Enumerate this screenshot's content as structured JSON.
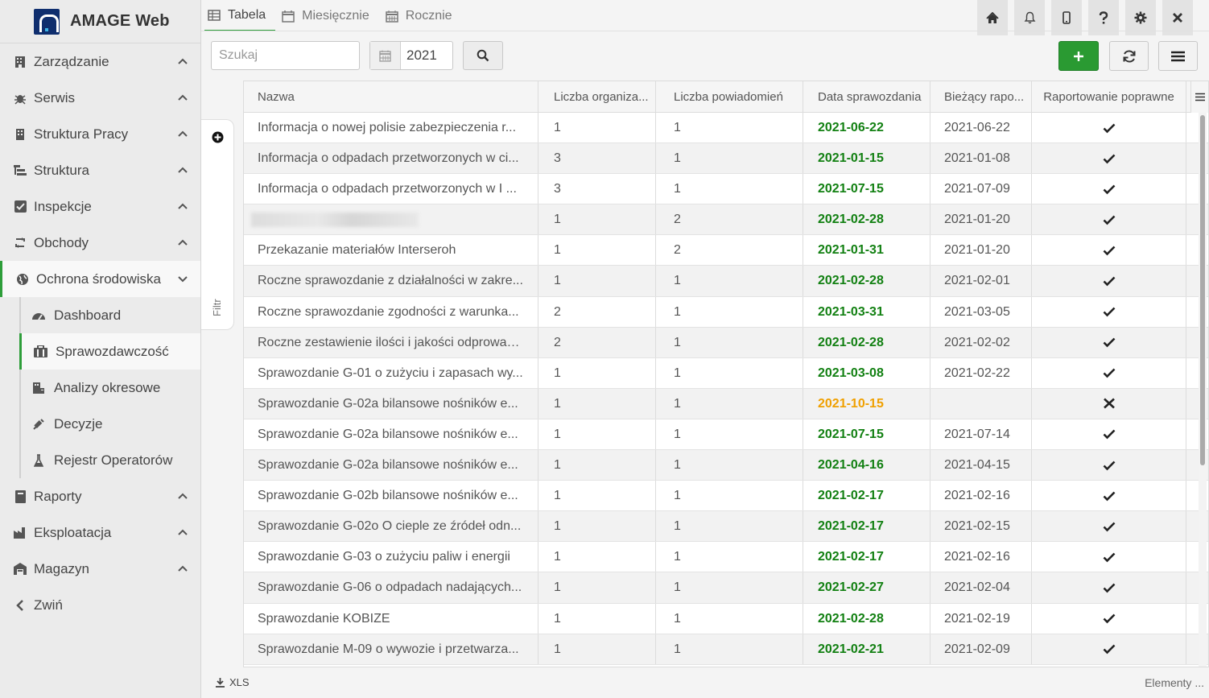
{
  "app": {
    "title": "AMAGE Web"
  },
  "sidebar": {
    "items": [
      {
        "label": "Zarządzanie",
        "icon": "building-icon"
      },
      {
        "label": "Serwis",
        "icon": "bug-icon"
      },
      {
        "label": "Struktura Pracy",
        "icon": "building-icon"
      },
      {
        "label": "Struktura",
        "icon": "tree-icon"
      },
      {
        "label": "Inspekcje",
        "icon": "check-square-icon"
      },
      {
        "label": "Obchody",
        "icon": "cycle-icon"
      },
      {
        "label": "Ochrona środowiska",
        "icon": "globe-icon"
      }
    ],
    "subitems": [
      {
        "label": "Dashboard",
        "icon": "gauge-icon"
      },
      {
        "label": "Sprawozdawczość",
        "icon": "briefcase-icon"
      },
      {
        "label": "Analizy okresowe",
        "icon": "building-chart-icon"
      },
      {
        "label": "Decyzje",
        "icon": "syringe-icon"
      },
      {
        "label": "Rejestr Operatorów",
        "icon": "flask-icon"
      }
    ],
    "bottom": [
      {
        "label": "Raporty",
        "icon": "book-icon"
      },
      {
        "label": "Eksploatacja",
        "icon": "factory-icon"
      },
      {
        "label": "Magazyn",
        "icon": "warehouse-icon"
      }
    ],
    "collapse_label": "Zwiń"
  },
  "tabs": [
    {
      "label": "Tabela",
      "icon": "table-icon"
    },
    {
      "label": "Miesięcznie",
      "icon": "calendar-icon"
    },
    {
      "label": "Rocznie",
      "icon": "calendar-grid-icon"
    }
  ],
  "toolbar": {
    "search_placeholder": "Szukaj",
    "year": "2021"
  },
  "filter": {
    "label": "Filtr"
  },
  "grid": {
    "columns": [
      "Nazwa",
      "Liczba organiza...",
      "Liczba powiadomień",
      "Data sprawozdania",
      "Bieżący rapo...",
      "Raportowanie poprawne"
    ],
    "rows": [
      {
        "name": "Informacja o nowej polisie zabezpieczenia r...",
        "orgs": "1",
        "notif": "1",
        "date": "2021-06-22",
        "status": "ok",
        "current": "2021-06-22",
        "correct": true
      },
      {
        "name": "Informacja o odpadach przetworzonych w ci...",
        "orgs": "3",
        "notif": "1",
        "date": "2021-01-15",
        "status": "ok",
        "current": "2021-01-08",
        "correct": true
      },
      {
        "name": "Informacja o odpadach przetworzonych w I ...",
        "orgs": "3",
        "notif": "1",
        "date": "2021-07-15",
        "status": "ok",
        "current": "2021-07-09",
        "correct": true
      },
      {
        "name": "",
        "orgs": "1",
        "notif": "2",
        "date": "2021-02-28",
        "status": "ok",
        "current": "2021-01-20",
        "correct": true
      },
      {
        "name": "Przekazanie materiałów Interseroh",
        "orgs": "1",
        "notif": "2",
        "date": "2021-01-31",
        "status": "ok",
        "current": "2021-01-20",
        "correct": true
      },
      {
        "name": "Roczne sprawozdanie z działalności w zakre...",
        "orgs": "1",
        "notif": "1",
        "date": "2021-02-28",
        "status": "ok",
        "current": "2021-02-01",
        "correct": true
      },
      {
        "name": "Roczne sprawozdanie zgodności z warunka...",
        "orgs": "2",
        "notif": "1",
        "date": "2021-03-31",
        "status": "ok",
        "current": "2021-03-05",
        "correct": true
      },
      {
        "name": "Roczne zestawienie ilości i jakości odprowad...",
        "orgs": "2",
        "notif": "1",
        "date": "2021-02-28",
        "status": "ok",
        "current": "2021-02-02",
        "correct": true
      },
      {
        "name": "Sprawozdanie G-01 o zużyciu i zapasach wy...",
        "orgs": "1",
        "notif": "1",
        "date": "2021-03-08",
        "status": "ok",
        "current": "2021-02-22",
        "correct": true
      },
      {
        "name": "Sprawozdanie G-02a bilansowe nośników e...",
        "orgs": "1",
        "notif": "1",
        "date": "2021-10-15",
        "status": "warn",
        "current": "",
        "correct": false
      },
      {
        "name": "Sprawozdanie G-02a bilansowe nośników e...",
        "orgs": "1",
        "notif": "1",
        "date": "2021-07-15",
        "status": "ok",
        "current": "2021-07-14",
        "correct": true
      },
      {
        "name": "Sprawozdanie G-02a bilansowe nośników e...",
        "orgs": "1",
        "notif": "1",
        "date": "2021-04-16",
        "status": "ok",
        "current": "2021-04-15",
        "correct": true
      },
      {
        "name": "Sprawozdanie G-02b bilansowe nośników e...",
        "orgs": "1",
        "notif": "1",
        "date": "2021-02-17",
        "status": "ok",
        "current": "2021-02-16",
        "correct": true
      },
      {
        "name": "Sprawozdanie G-02o O cieple ze źródeł odn...",
        "orgs": "1",
        "notif": "1",
        "date": "2021-02-17",
        "status": "ok",
        "current": "2021-02-15",
        "correct": true
      },
      {
        "name": "Sprawozdanie G-03 o zużyciu paliw i energii",
        "orgs": "1",
        "notif": "1",
        "date": "2021-02-17",
        "status": "ok",
        "current": "2021-02-16",
        "correct": true
      },
      {
        "name": "Sprawozdanie G-06 o odpadach nadających...",
        "orgs": "1",
        "notif": "1",
        "date": "2021-02-27",
        "status": "ok",
        "current": "2021-02-04",
        "correct": true
      },
      {
        "name": "Sprawozdanie KOBIZE",
        "orgs": "1",
        "notif": "1",
        "date": "2021-02-28",
        "status": "ok",
        "current": "2021-02-19",
        "correct": true
      },
      {
        "name": "Sprawozdanie M-09 o wywozie i przetwarza...",
        "orgs": "1",
        "notif": "1",
        "date": "2021-02-21",
        "status": "ok",
        "current": "2021-02-09",
        "correct": true
      }
    ]
  },
  "footer": {
    "export_label": "XLS",
    "elements_label": "Elementy ..."
  },
  "colors": {
    "accent": "#2e9e3a",
    "date_ok": "#128012",
    "date_warn": "#f0a000",
    "brand": "#0f2e6e"
  }
}
